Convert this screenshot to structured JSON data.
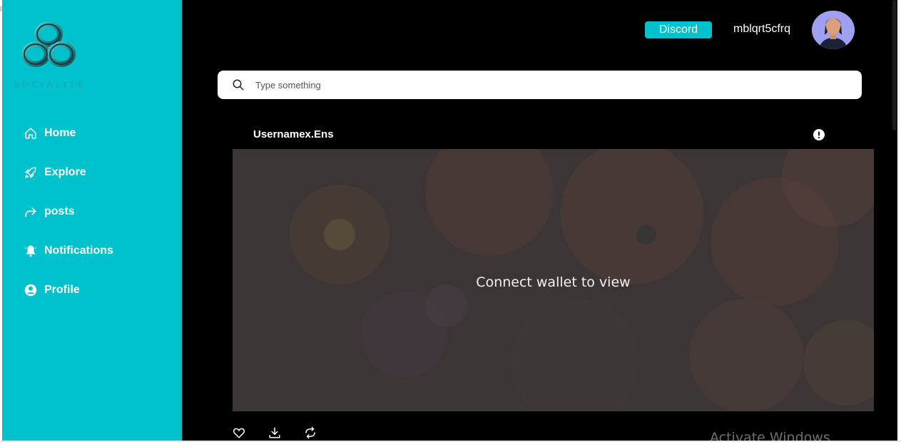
{
  "corner_glyph": "F",
  "brand": {
    "logo_text": "SOCIALITE"
  },
  "sidebar": {
    "items": [
      {
        "label": "Home",
        "icon": "home-icon"
      },
      {
        "label": "Explore",
        "icon": "rocket-icon"
      },
      {
        "label": "posts",
        "icon": "share-arrow-icon"
      },
      {
        "label": "Notifications",
        "icon": "bell-icon"
      },
      {
        "label": "Profile",
        "icon": "user-circle-icon"
      }
    ]
  },
  "header": {
    "discord_label": "Discord",
    "username": "mblqrt5cfrq",
    "avatar_icon": "user-avatar"
  },
  "search": {
    "placeholder": "Type something",
    "value": ""
  },
  "post": {
    "author": "Usernamex.Ens",
    "locked_message": "Connect wallet to view",
    "actions": [
      {
        "name": "like",
        "icon": "heart-icon"
      },
      {
        "name": "download",
        "icon": "download-icon"
      },
      {
        "name": "repost",
        "icon": "repost-icon"
      }
    ]
  },
  "watermark": "Activate Windows",
  "colors": {
    "accent": "#00c2cc",
    "main_bg": "#000000",
    "card_overlay": "#3c3939"
  }
}
